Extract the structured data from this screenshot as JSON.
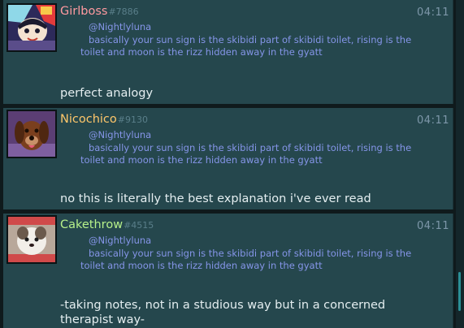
{
  "messages": [
    {
      "username": "Girlboss",
      "discriminator": "#7886",
      "username_color": "#ff9aa0",
      "timestamp": "04:11",
      "reply_mention": "@Nightlyluna",
      "reply_text": "basically your sun sign is the skibidi part of skibidi toilet, rising is the toilet and moon is the rizz hidden away in the gyatt",
      "body": "perfect analogy"
    },
    {
      "username": "Nicochico",
      "discriminator": "#9130",
      "username_color": "#ffc76a",
      "timestamp": "04:11",
      "reply_mention": "@Nightlyluna",
      "reply_text": "basically your sun sign is the skibidi part of skibidi toilet, rising is the toilet and moon is the rizz hidden away in the gyatt",
      "body": "no this is literally the best explanation i've ever read"
    },
    {
      "username": "Cakethrow",
      "discriminator": "#4515",
      "username_color": "#b6f08a",
      "timestamp": "04:11",
      "reply_mention": "@Nightlyluna",
      "reply_text": "basically your sun sign is the skibidi part of skibidi toilet, rising is the toilet and moon is the rizz hidden away in the gyatt",
      "body": "-taking notes, not in a studious way but in a concerned therapist way-"
    }
  ]
}
